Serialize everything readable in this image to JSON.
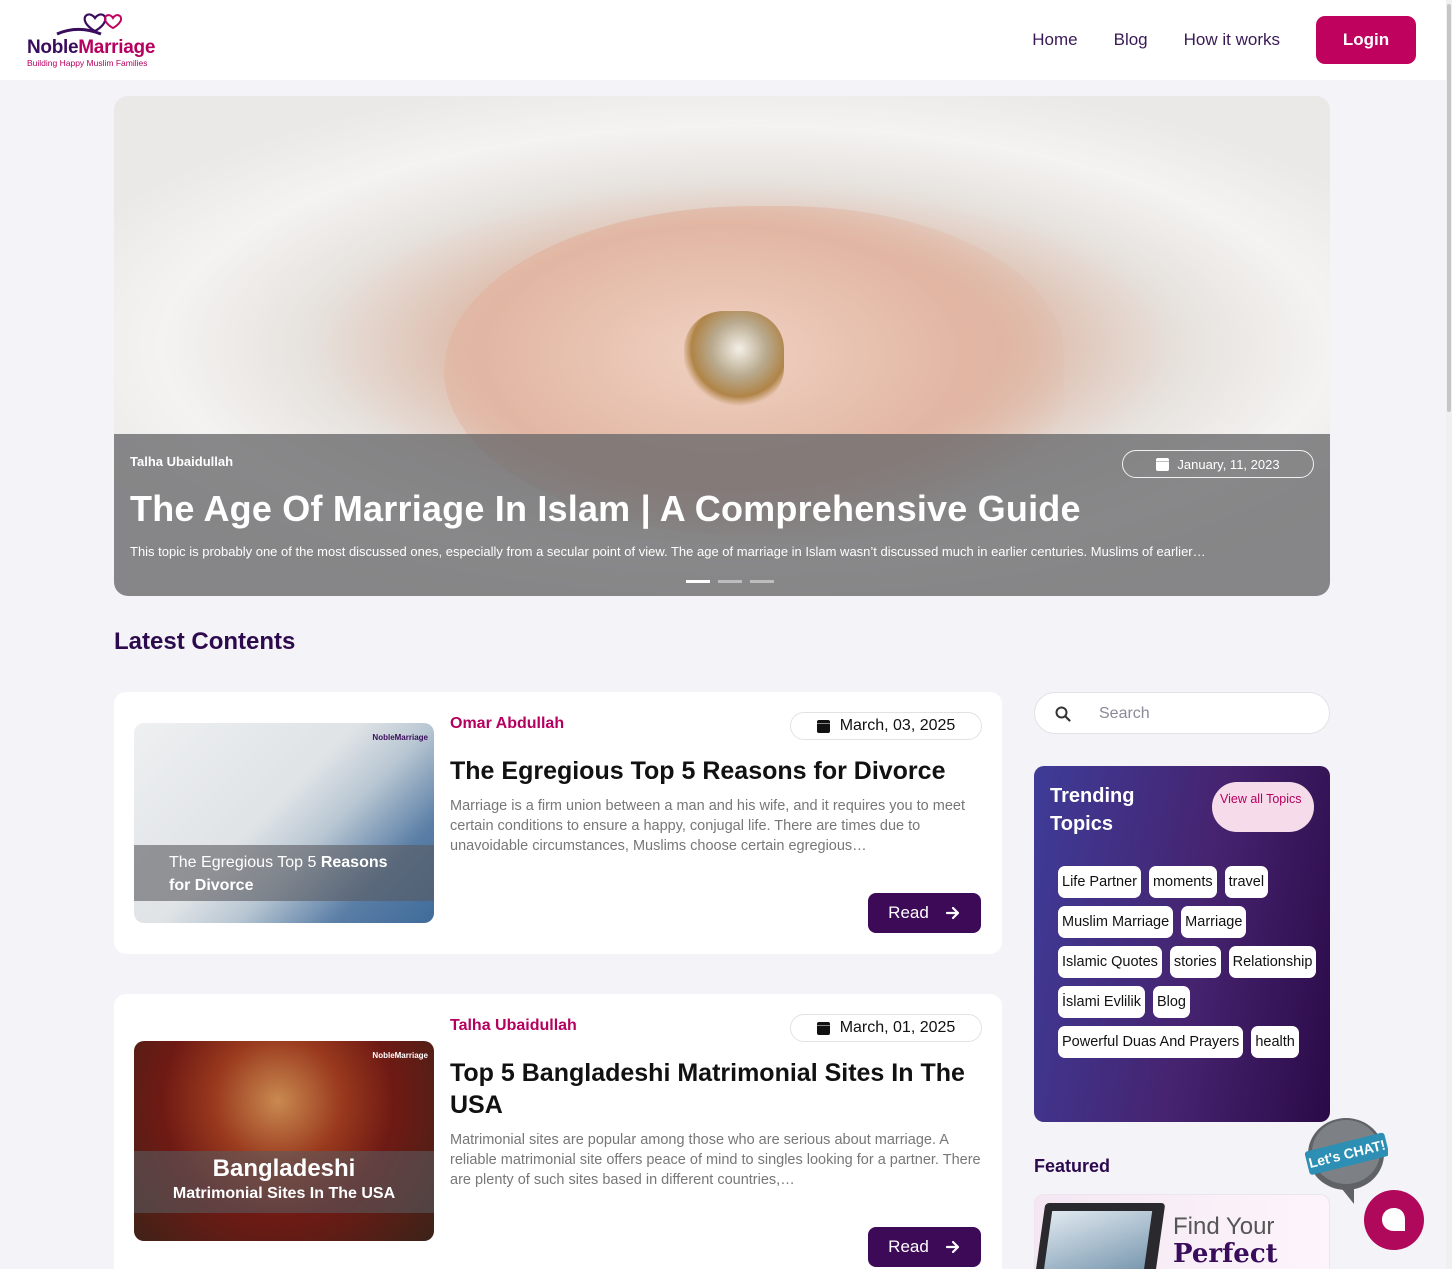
{
  "header": {
    "logo_name_a": "Noble",
    "logo_name_b": "Marriage",
    "logo_tagline": "Building Happy Muslim Families",
    "nav": [
      "Home",
      "Blog",
      "How it works"
    ],
    "login_label": "Login"
  },
  "hero": {
    "author": "Talha Ubaidullah",
    "date": "January, 11, 2023",
    "title": "The Age Of Marriage In Islam | A Comprehensive Guide",
    "excerpt": "This topic is probably one of the most discussed ones, especially from a secular point of view. The age of marriage in Islam wasn’t discussed much in earlier centuries. Muslims of earlier…",
    "slide_count": 3,
    "active_slide": 1
  },
  "section_title": "Latest Contents",
  "posts": [
    {
      "author": "Omar Abdullah",
      "date": "March, 03, 2025",
      "title": "The Egregious Top 5 Reasons for Divorce",
      "excerpt": "Marriage is a firm union between a man and his wife, and it requires you to meet certain conditions to ensure a happy, conjugal life. There are times due to unavoidable circumstances, Muslims choose certain egregious…",
      "thumb_text_a": "The Egregious Top 5 ",
      "thumb_text_b": "Reasons",
      "thumb_text_c": "for Divorce",
      "thumb_logo": "NobleMarriage",
      "read_label": "Read"
    },
    {
      "author": "Talha Ubaidullah",
      "date": "March, 01, 2025",
      "title": "Top 5 Bangladeshi Matrimonial Sites In The USA",
      "excerpt": "Matrimonial sites are popular among those who are serious about marriage. A reliable matrimonial site offers peace of mind to singles looking for a partner. There are plenty of such sites based in different countries,…",
      "thumb_text_a": "Bangladeshi",
      "thumb_text_b": "Matrimonial Sites In The USA",
      "thumb_logo": "NobleMarriage",
      "read_label": "Read"
    }
  ],
  "sidebar": {
    "search_placeholder": "Search",
    "trending_title": "Trending Topics",
    "view_all_label": "View all Topics",
    "tags": [
      "Life Partner",
      "moments",
      "travel",
      "Muslim Marriage",
      "Marriage",
      "Islamic Quotes",
      "stories",
      "Relationship",
      "İslami Evlilik",
      "Blog",
      "Powerful Duas And Prayers",
      "health"
    ],
    "featured_title": "Featured",
    "featured_line1": "Find Your",
    "featured_line2": "Perfect"
  },
  "chat": {
    "badge_label": "Let's CHAT!"
  },
  "colors": {
    "brand_pink": "#c0025f",
    "brand_purple": "#3d0a58",
    "page_bg": "#f3f3f8"
  }
}
